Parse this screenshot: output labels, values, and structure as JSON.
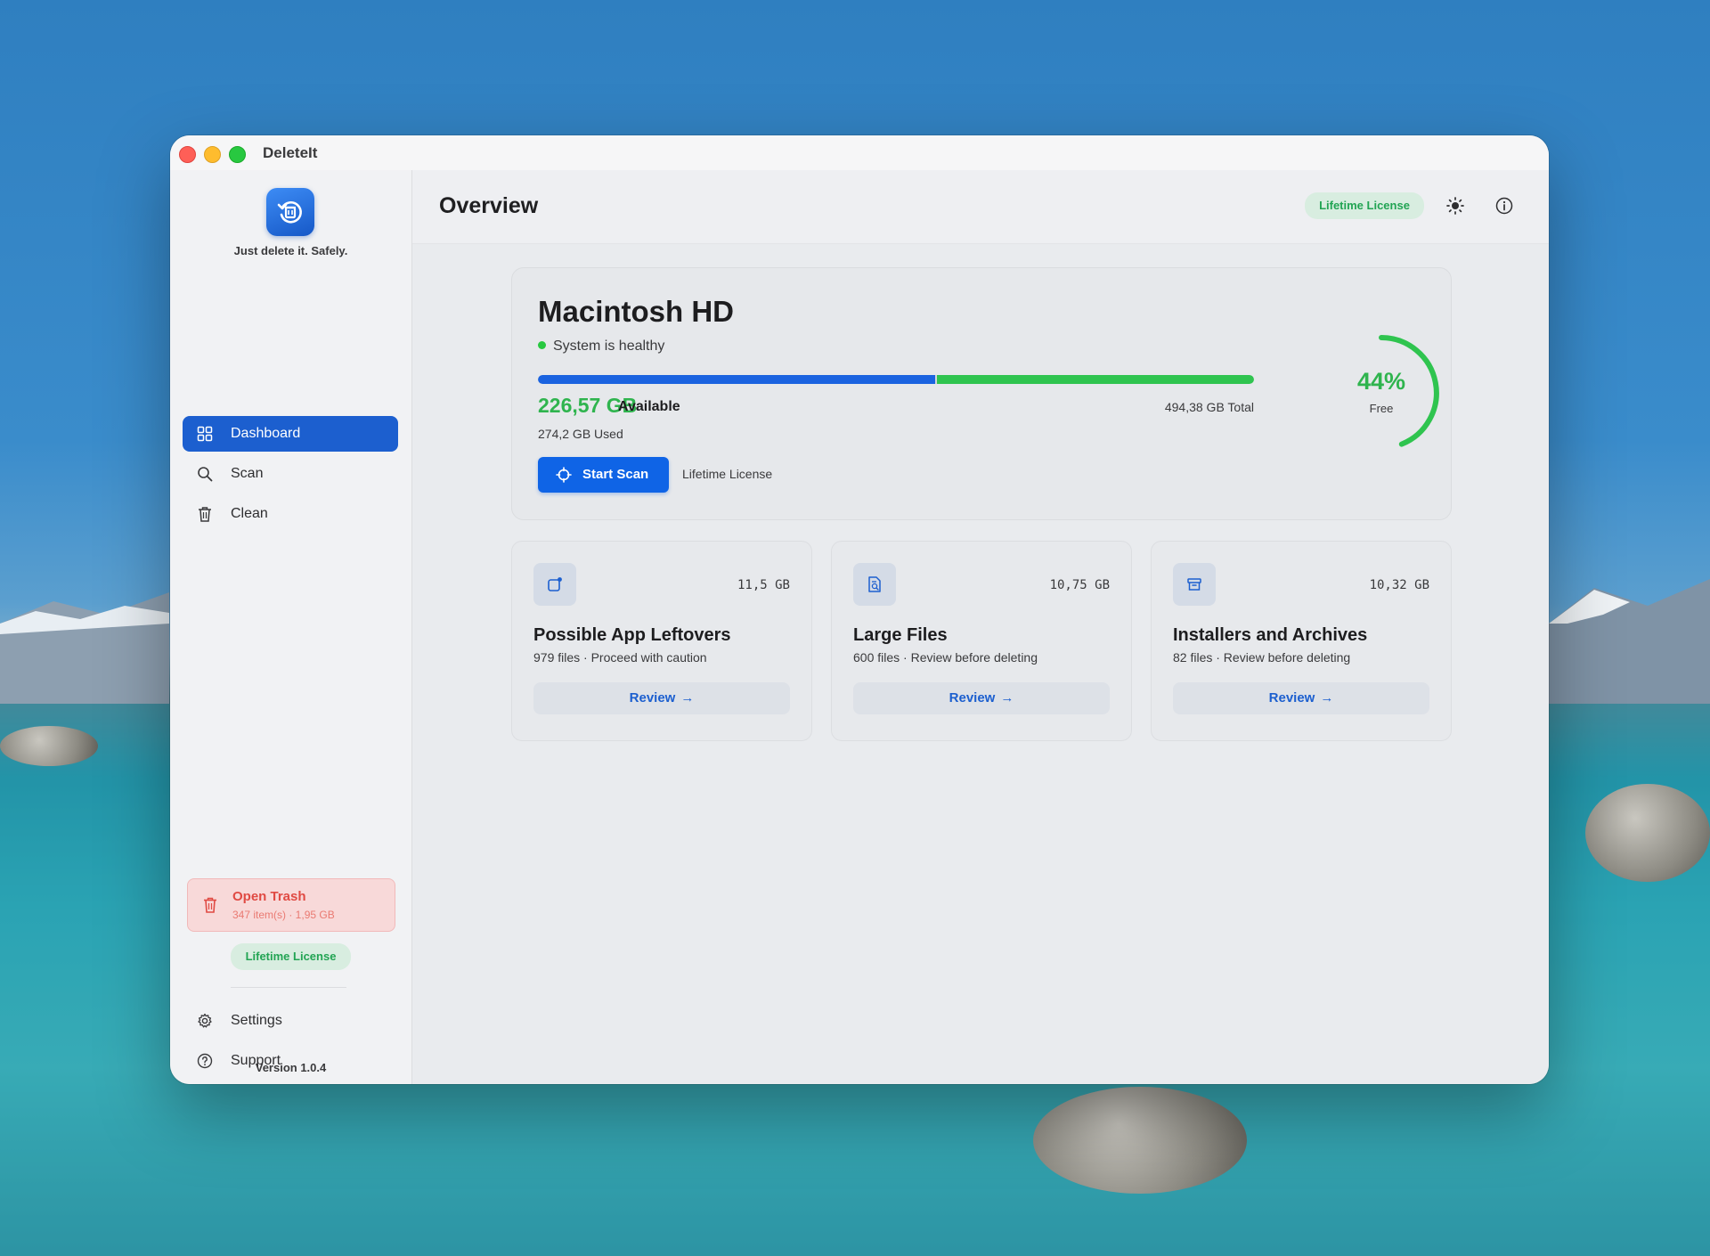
{
  "window": {
    "title": "DeleteIt"
  },
  "sidebar": {
    "tagline": "Just delete it. Safely.",
    "nav": [
      {
        "label": "Dashboard",
        "icon": "grid-icon",
        "active": true
      },
      {
        "label": "Scan",
        "icon": "search-icon",
        "active": false
      },
      {
        "label": "Clean",
        "icon": "trash-icon",
        "active": false
      }
    ],
    "trash": {
      "title": "Open Trash",
      "subtitle": "347 item(s) · 1,95 GB"
    },
    "license": "Lifetime License",
    "footer": [
      {
        "label": "Settings",
        "icon": "gear-icon"
      },
      {
        "label": "Support",
        "icon": "question-icon"
      }
    ],
    "version": "Version 1.0.4"
  },
  "header": {
    "title": "Overview",
    "license": "Lifetime License"
  },
  "disk": {
    "name": "Macintosh HD",
    "status": "System is healthy",
    "available_value": "226,57 GB",
    "available_label": "Available",
    "total": "494,38 GB Total",
    "used": "274,2 GB Used",
    "scan_button": "Start Scan",
    "license_text": "Lifetime License",
    "free_percent": "44%",
    "free_label": "Free",
    "free_fraction": 0.44,
    "used_fraction": 0.555
  },
  "categories": [
    {
      "title": "Possible App Leftovers",
      "subtitle": "979 files · Proceed with caution",
      "size": "11,5 GB",
      "button": "Review",
      "icon": "app-icon"
    },
    {
      "title": "Large Files",
      "subtitle": "600 files · Review before deleting",
      "size": "10,75 GB",
      "button": "Review",
      "icon": "file-search-icon"
    },
    {
      "title": "Installers and Archives",
      "subtitle": "82 files · Review before deleting",
      "size": "10,32 GB",
      "button": "Review",
      "icon": "archive-icon"
    }
  ],
  "colors": {
    "accent": "#1c5fcf",
    "success": "#2fb44e",
    "danger": "#e04a43"
  }
}
